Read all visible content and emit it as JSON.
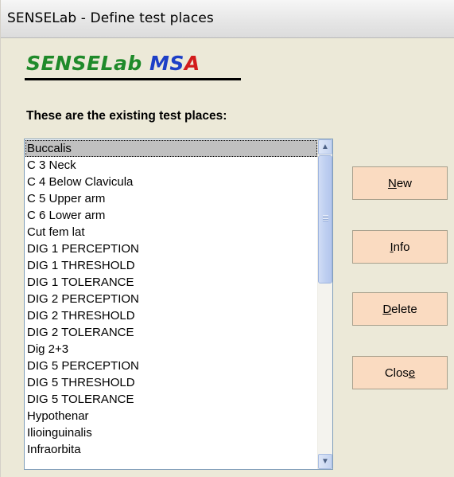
{
  "window": {
    "title": "SENSELab - Define test places"
  },
  "logo": {
    "part1": "SENSELab",
    "part2": "MS",
    "part3": "A"
  },
  "heading": "These are the existing test places:",
  "list": {
    "selected_index": 0,
    "items": [
      "Buccalis",
      "C 3 Neck",
      "C 4 Below Clavicula",
      "C 5 Upper arm",
      "C 6 Lower arm",
      "Cut fem lat",
      "DIG 1 PERCEPTION",
      "DIG 1 THRESHOLD",
      "DIG 1 TOLERANCE",
      "DIG 2 PERCEPTION",
      "DIG 2 THRESHOLD",
      "DIG 2 TOLERANCE",
      "Dig 2+3",
      "DIG 5 PERCEPTION",
      "DIG 5 THRESHOLD",
      "DIG 5 TOLERANCE",
      "Hypothenar",
      "Ilioinguinalis",
      "Infraorbita"
    ]
  },
  "buttons": {
    "new": {
      "before": "",
      "key": "N",
      "after": "ew"
    },
    "info": {
      "before": "",
      "key": "I",
      "after": "nfo"
    },
    "delete": {
      "before": "",
      "key": "D",
      "after": "elete"
    },
    "close": {
      "before": "Clos",
      "key": "e",
      "after": ""
    }
  },
  "colors": {
    "button_face": "#fadbc1",
    "logo_green": "#1f8a2a",
    "logo_blue": "#1d3fc7",
    "logo_red": "#d21b1b",
    "selection": "#c0c0c0"
  }
}
